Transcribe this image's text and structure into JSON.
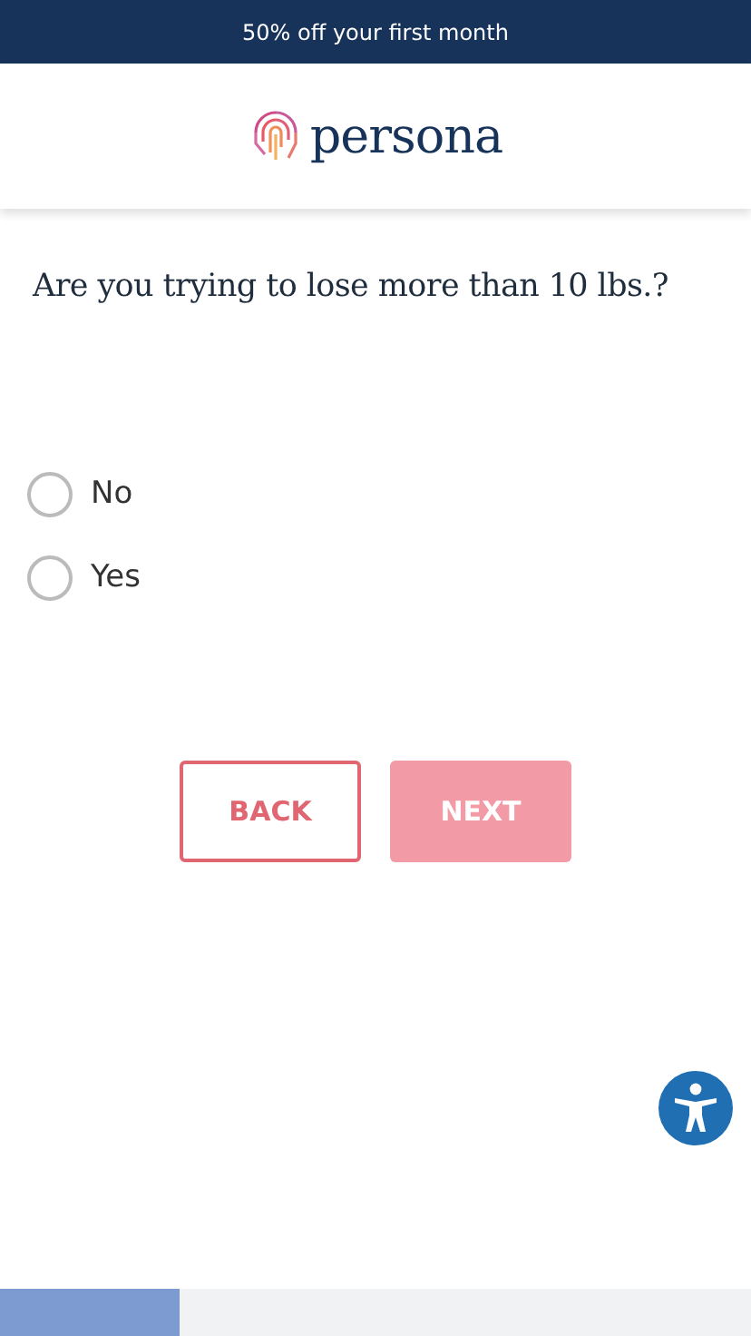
{
  "banner": {
    "text": "50% off your first month"
  },
  "logo": {
    "text": "persona"
  },
  "question": "Are you trying to lose more than 10 lbs.?",
  "options": [
    {
      "label": "No",
      "selected": false
    },
    {
      "label": "Yes",
      "selected": false
    }
  ],
  "buttons": [
    {
      "label": "BACK",
      "kind": "outline",
      "disabled": false
    },
    {
      "label": "NEXT",
      "kind": "solid",
      "disabled": true
    }
  ],
  "progress": {
    "level": 0.24
  }
}
